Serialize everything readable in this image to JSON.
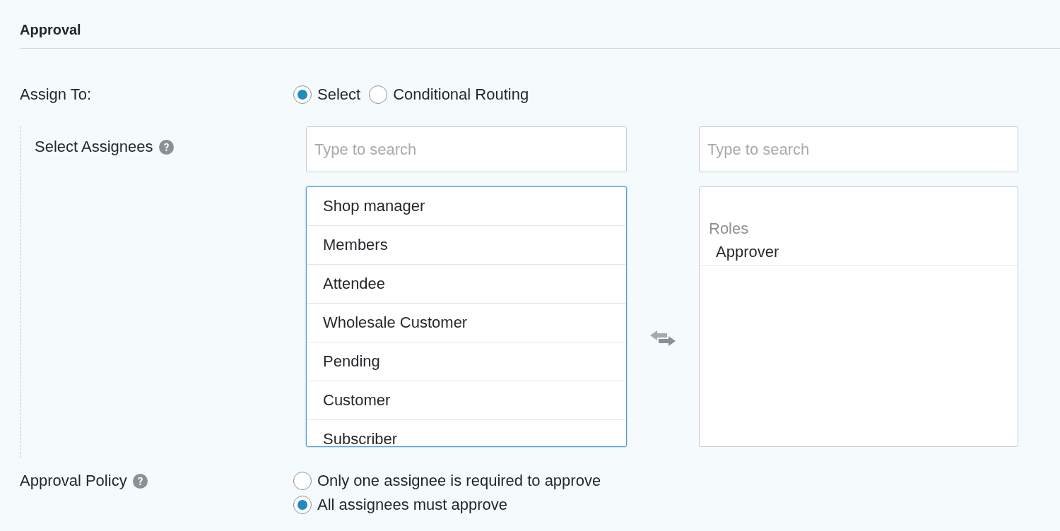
{
  "section": {
    "title": "Approval"
  },
  "assign_to": {
    "label": "Assign To:",
    "options": [
      {
        "label": "Select",
        "selected": true
      },
      {
        "label": "Conditional Routing",
        "selected": false
      }
    ]
  },
  "assignees": {
    "label": "Select Assignees",
    "available_search": {
      "placeholder": "Type to search"
    },
    "selected_search": {
      "placeholder": "Type to search"
    },
    "available": [
      "Shop manager",
      "Members",
      "Attendee",
      "Wholesale Customer",
      "Pending",
      "Customer",
      "Subscriber"
    ],
    "selected_groups": [
      {
        "label": "Roles",
        "items": [
          "Approver"
        ]
      }
    ]
  },
  "approval_policy": {
    "label": "Approval Policy",
    "options": [
      {
        "label": "Only one assignee is required to approve",
        "selected": false
      },
      {
        "label": "All assignees must approve",
        "selected": true
      }
    ]
  }
}
